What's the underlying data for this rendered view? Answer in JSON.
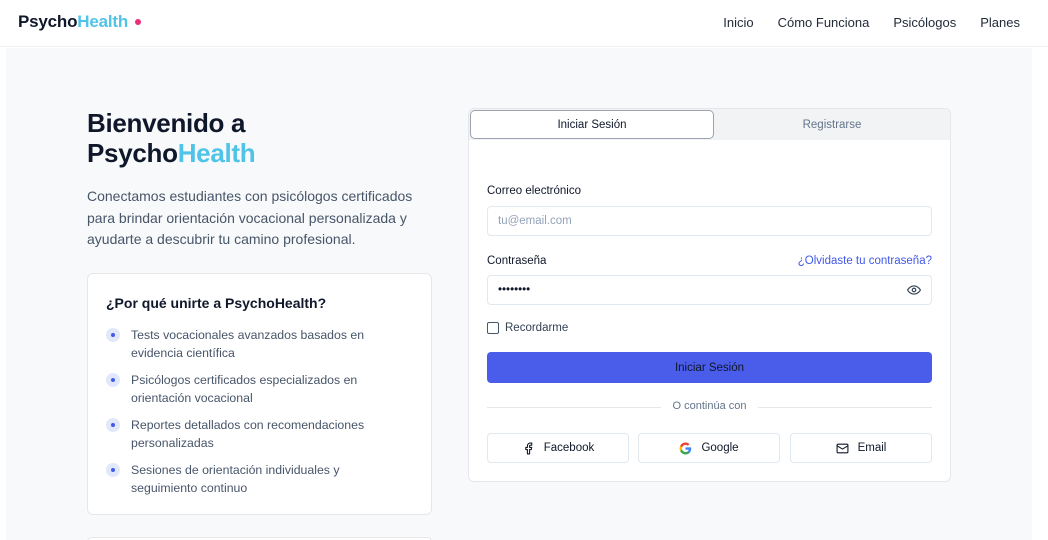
{
  "brand": {
    "part1": "Psycho",
    "part2": "Health"
  },
  "nav": {
    "items": [
      "Inicio",
      "Cómo Funciona",
      "Psicólogos",
      "Planes"
    ]
  },
  "hero": {
    "title_line1": "Bienvenido a",
    "title_part1": "Psycho",
    "title_part2": "Health",
    "description": "Conectamos estudiantes con psicólogos certificados para brindar orientación vocacional personalizada y ayudarte a descubrir tu camino profesional."
  },
  "why": {
    "title": "¿Por qué unirte a PsychoHealth?",
    "items": [
      "Tests vocacionales avanzados basados en evidencia científica",
      "Psicólogos certificados especializados en orientación vocacional",
      "Reportes detallados con recomendaciones personalizadas",
      "Sesiones de orientación individuales y seguimiento continuo"
    ]
  },
  "auth": {
    "tabs": [
      "Iniciar Sesión",
      "Registrarse"
    ],
    "email_label": "Correo electrónico",
    "email_placeholder": "tu@email.com",
    "password_label": "Contraseña",
    "forgot_link": "¿Olvidaste tu contraseña?",
    "password_value": "••••••••",
    "remember_label": "Recordarme",
    "submit_label": "Iniciar Sesión",
    "divider_text": "O continúa con",
    "social": [
      "Facebook",
      "Google",
      "Email"
    ]
  },
  "colors": {
    "brand_accent": "#4fc3e8",
    "brand_dot": "#ec2d7a",
    "primary": "#4a5cea",
    "link": "#4259e8"
  }
}
